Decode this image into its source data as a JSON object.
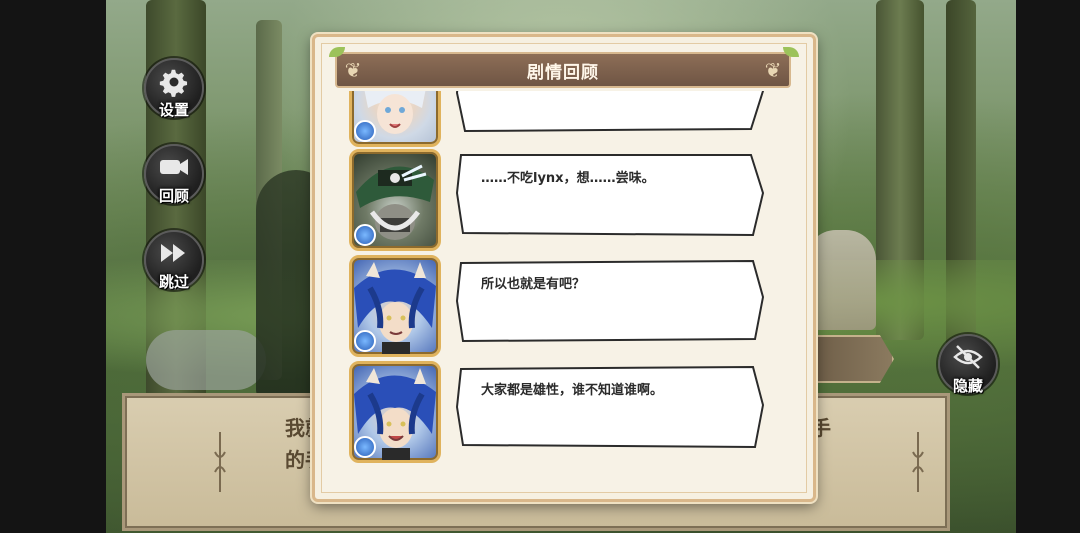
{
  "side_buttons": {
    "settings": {
      "label": "设置",
      "icon": "gear-icon"
    },
    "review": {
      "label": "回顾",
      "icon": "camera-icon"
    },
    "skip": {
      "label": "跳过",
      "icon": "fast-forward-icon"
    },
    "hide": {
      "label": "隐藏",
      "icon": "eye-off-icon"
    }
  },
  "background_dialog": {
    "line1_start": "我就",
    "line1_end": "手",
    "line2_start": "的手"
  },
  "modal": {
    "title": "剧情回顾",
    "entries": [
      {
        "character": "silver-haired-elf",
        "element": "water",
        "text": ""
      },
      {
        "character": "masked-pirate",
        "element": "water",
        "text": "……不吃lynx，想……尝味。"
      },
      {
        "character": "blue-haired-beastman",
        "element": "water",
        "text": "所以也就是有吧？"
      },
      {
        "character": "blue-haired-beastman",
        "element": "water",
        "text": "大家都是雄性，谁不知道谁啊。"
      }
    ]
  },
  "colors": {
    "title_bar": "#7a5e4b",
    "modal_bg": "#f6f0e1",
    "avatar_frame": "#e0b35d",
    "dialog_bg": "#d9cdb0"
  }
}
